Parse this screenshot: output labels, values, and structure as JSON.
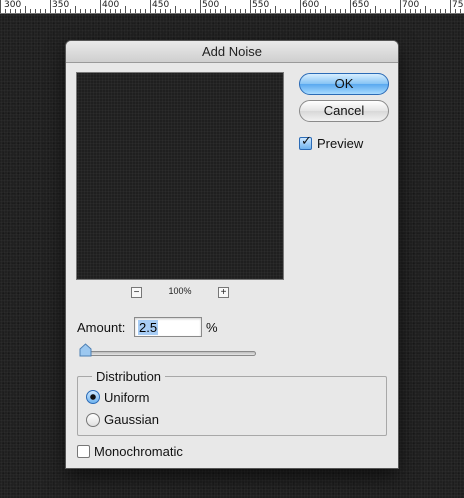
{
  "ruler": {
    "labels": [
      "300",
      "350",
      "400",
      "450",
      "500",
      "550",
      "600",
      "650",
      "700",
      "75"
    ]
  },
  "dialog": {
    "title": "Add Noise",
    "ok_label": "OK",
    "cancel_label": "Cancel",
    "preview_label": "Preview",
    "preview_checked": true,
    "zoom": {
      "minus": "−",
      "plus": "+",
      "level": "100%"
    },
    "amount": {
      "label": "Amount:",
      "value": "2.5",
      "unit": "%",
      "slider_percent": 0.5
    },
    "distribution": {
      "title": "Distribution",
      "options": [
        "Uniform",
        "Gaussian"
      ],
      "selected": "Uniform"
    },
    "monochromatic": {
      "label": "Monochromatic",
      "checked": false
    }
  },
  "colors": {
    "canvas": "#202020",
    "dialog_bg": "#e8e8e8",
    "accent_blue": "#5aa8ef"
  }
}
